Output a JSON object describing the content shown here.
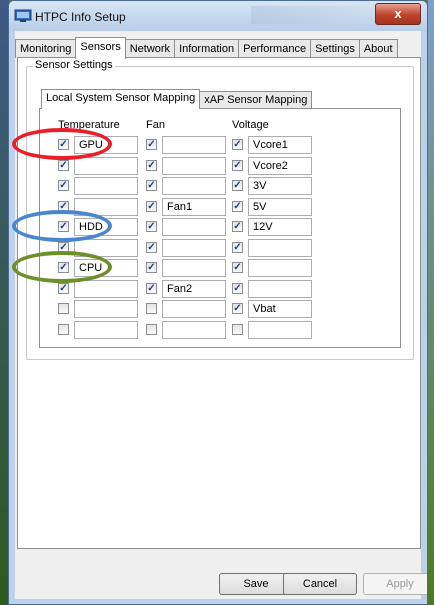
{
  "window": {
    "title": "HTPC Info Setup",
    "close_glyph": "x"
  },
  "tabs": [
    "Monitoring",
    "Sensors",
    "Network",
    "Information",
    "Performance",
    "Settings",
    "About"
  ],
  "active_tab": "Sensors",
  "group": {
    "label": "Sensor Settings"
  },
  "inner_tabs": [
    "Local System Sensor Mapping",
    "xAP Sensor Mapping"
  ],
  "active_inner_tab": "Local System Sensor Mapping",
  "columns": {
    "temperature": "Temperature",
    "fan": "Fan",
    "voltage": "Voltage"
  },
  "rows": [
    {
      "temp": {
        "checked": true,
        "value": "GPU"
      },
      "fan": {
        "checked": true,
        "value": ""
      },
      "volt": {
        "checked": true,
        "value": "Vcore1"
      }
    },
    {
      "temp": {
        "checked": true,
        "value": ""
      },
      "fan": {
        "checked": true,
        "value": ""
      },
      "volt": {
        "checked": true,
        "value": "Vcore2"
      }
    },
    {
      "temp": {
        "checked": true,
        "value": ""
      },
      "fan": {
        "checked": true,
        "value": ""
      },
      "volt": {
        "checked": true,
        "value": "3V"
      }
    },
    {
      "temp": {
        "checked": true,
        "value": ""
      },
      "fan": {
        "checked": true,
        "value": "Fan1"
      },
      "volt": {
        "checked": true,
        "value": "5V"
      }
    },
    {
      "temp": {
        "checked": true,
        "value": "HDD"
      },
      "fan": {
        "checked": true,
        "value": ""
      },
      "volt": {
        "checked": true,
        "value": "12V"
      }
    },
    {
      "temp": {
        "checked": true,
        "value": ""
      },
      "fan": {
        "checked": true,
        "value": ""
      },
      "volt": {
        "checked": true,
        "value": ""
      }
    },
    {
      "temp": {
        "checked": true,
        "value": "CPU"
      },
      "fan": {
        "checked": true,
        "value": ""
      },
      "volt": {
        "checked": true,
        "value": ""
      }
    },
    {
      "temp": {
        "checked": true,
        "value": ""
      },
      "fan": {
        "checked": true,
        "value": "Fan2"
      },
      "volt": {
        "checked": true,
        "value": ""
      }
    },
    {
      "temp": {
        "checked": false,
        "value": ""
      },
      "fan": {
        "checked": false,
        "value": ""
      },
      "volt": {
        "checked": true,
        "value": "Vbat"
      }
    },
    {
      "temp": {
        "checked": false,
        "value": ""
      },
      "fan": {
        "checked": false,
        "value": ""
      },
      "volt": {
        "checked": false,
        "value": ""
      }
    }
  ],
  "annotations": [
    {
      "row": 0,
      "color": "#e8202a"
    },
    {
      "row": 4,
      "color": "#4a86d0"
    },
    {
      "row": 6,
      "color": "#6f8f2a"
    }
  ],
  "buttons": {
    "save": "Save",
    "cancel": "Cancel",
    "apply": "Apply"
  },
  "checkmark_glyph": "✓",
  "colors": {
    "titlebar": "#bcd2ea",
    "close": "#c0422c"
  }
}
